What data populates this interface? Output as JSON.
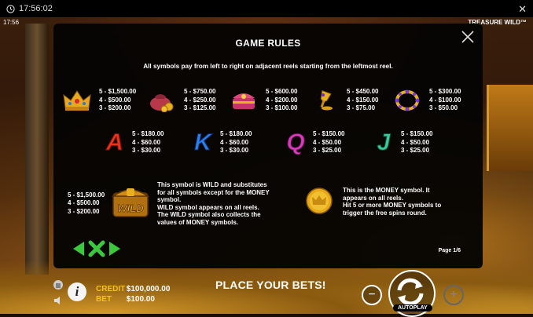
{
  "browser": {
    "time": "17:56:02"
  },
  "game": {
    "time": "17:56",
    "title": "TREASURE WILD™"
  },
  "modal": {
    "title": "GAME RULES",
    "subtitle": "All symbols pay from left to right on adjacent reels starting from the leftmost reel.",
    "page": "Page 1/6"
  },
  "symbols": [
    {
      "icon": "crown-icon",
      "pays": [
        "5 - $1,500.00",
        "4 - $500.00",
        "3 - $200.00"
      ]
    },
    {
      "icon": "treasure-bag-icon",
      "pays": [
        "5 - $750.00",
        "4 - $250.00",
        "3 - $125.00"
      ]
    },
    {
      "icon": "jewel-box-icon",
      "pays": [
        "5 - $600.00",
        "4 - $200.00",
        "3 - $100.00"
      ]
    },
    {
      "icon": "golden-goblet-icon",
      "pays": [
        "5 - $450.00",
        "4 - $150.00",
        "3 - $75.00"
      ]
    },
    {
      "icon": "bracelet-icon",
      "pays": [
        "5 - $300.00",
        "4 - $100.00",
        "3 - $50.00"
      ]
    },
    {
      "icon": "letter-a-icon",
      "glyph": "A",
      "color": "#e8341c",
      "pays": [
        "5 - $180.00",
        "4 - $60.00",
        "3 - $30.00"
      ]
    },
    {
      "icon": "letter-k-icon",
      "glyph": "K",
      "color": "#2f7fe8",
      "pays": [
        "5 - $180.00",
        "4 - $60.00",
        "3 - $30.00"
      ]
    },
    {
      "icon": "letter-q-icon",
      "glyph": "Q",
      "color": "#d43fb8",
      "pays": [
        "5 - $150.00",
        "4 - $50.00",
        "3 - $25.00"
      ]
    },
    {
      "icon": "letter-j-icon",
      "glyph": "J",
      "color": "#3fc8a0",
      "pays": [
        "5 - $150.00",
        "4 - $50.00",
        "3 - $25.00"
      ]
    }
  ],
  "wild": {
    "label": "WILD",
    "pays": [
      "5 - $1,500.00",
      "4 - $500.00",
      "3 - $200.00"
    ],
    "desc": [
      "This symbol is WILD and substitutes",
      "for all symbols except for the MONEY",
      "symbol.",
      "WILD symbol appears on all reels.",
      "The WILD symbol also collects the",
      "values of MONEY symbols."
    ]
  },
  "money": {
    "desc": [
      "This is the MONEY symbol. It",
      "appears on all reels.",
      "Hit 5 or more MONEY symbols to",
      "trigger the free spins round."
    ]
  },
  "bottom": {
    "credit_label": "CREDIT",
    "credit_value": "$100,000.00",
    "bet_label": "BET",
    "bet_value": "$100.00",
    "message": "PLACE YOUR BETS!",
    "autoplay": "AUTOPLAY",
    "info": "i",
    "minus": "−",
    "plus": "+"
  },
  "colors": {
    "accent_yellow": "#f4c21a",
    "arrow_green": "#3cc83c",
    "modal_bg": "#050403"
  }
}
